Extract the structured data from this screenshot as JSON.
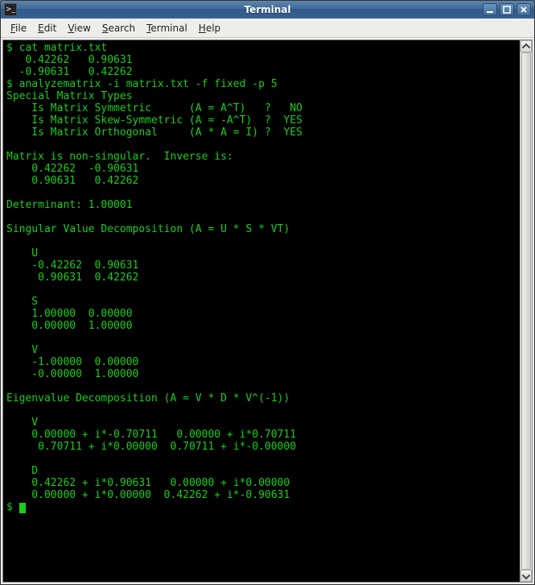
{
  "window": {
    "title": "Terminal",
    "icon_glyph": ">_"
  },
  "menu": {
    "file": "File",
    "edit": "Edit",
    "view": "View",
    "search": "Search",
    "terminal": "Terminal",
    "help": "Help"
  },
  "terminal": {
    "lines": [
      "$ cat matrix.txt",
      "   0.42262   0.90631",
      "  -0.90631   0.42262",
      "$ analyzematrix -i matrix.txt -f fixed -p 5",
      "Special Matrix Types",
      "    Is Matrix Symmetric      (A = A^T)   ?   NO",
      "    Is Matrix Skew-Symmetric (A = -A^T)  ?  YES",
      "    Is Matrix Orthogonal     (A * A = I) ?  YES",
      "",
      "Matrix is non-singular.  Inverse is:",
      "    0.42262  -0.90631",
      "    0.90631   0.42262",
      "",
      "Determinant: 1.00001",
      "",
      "Singular Value Decomposition (A = U * S * VT)",
      "",
      "    U",
      "    -0.42262  0.90631",
      "     0.90631  0.42262",
      "",
      "    S",
      "    1.00000  0.00000",
      "    0.00000  1.00000",
      "",
      "    V",
      "    -1.00000  0.00000",
      "    -0.00000  1.00000",
      "",
      "Eigenvalue Decomposition (A = V * D * V^(-1))",
      "",
      "    V",
      "    0.00000 + i*-0.70711   0.00000 + i*0.70711",
      "     0.70711 + i*0.00000  0.70711 + i*-0.00000",
      "",
      "    D",
      "    0.42262 + i*0.90631   0.00000 + i*0.00000",
      "    0.00000 + i*0.00000  0.42262 + i*-0.90631"
    ],
    "prompt": "$ "
  }
}
